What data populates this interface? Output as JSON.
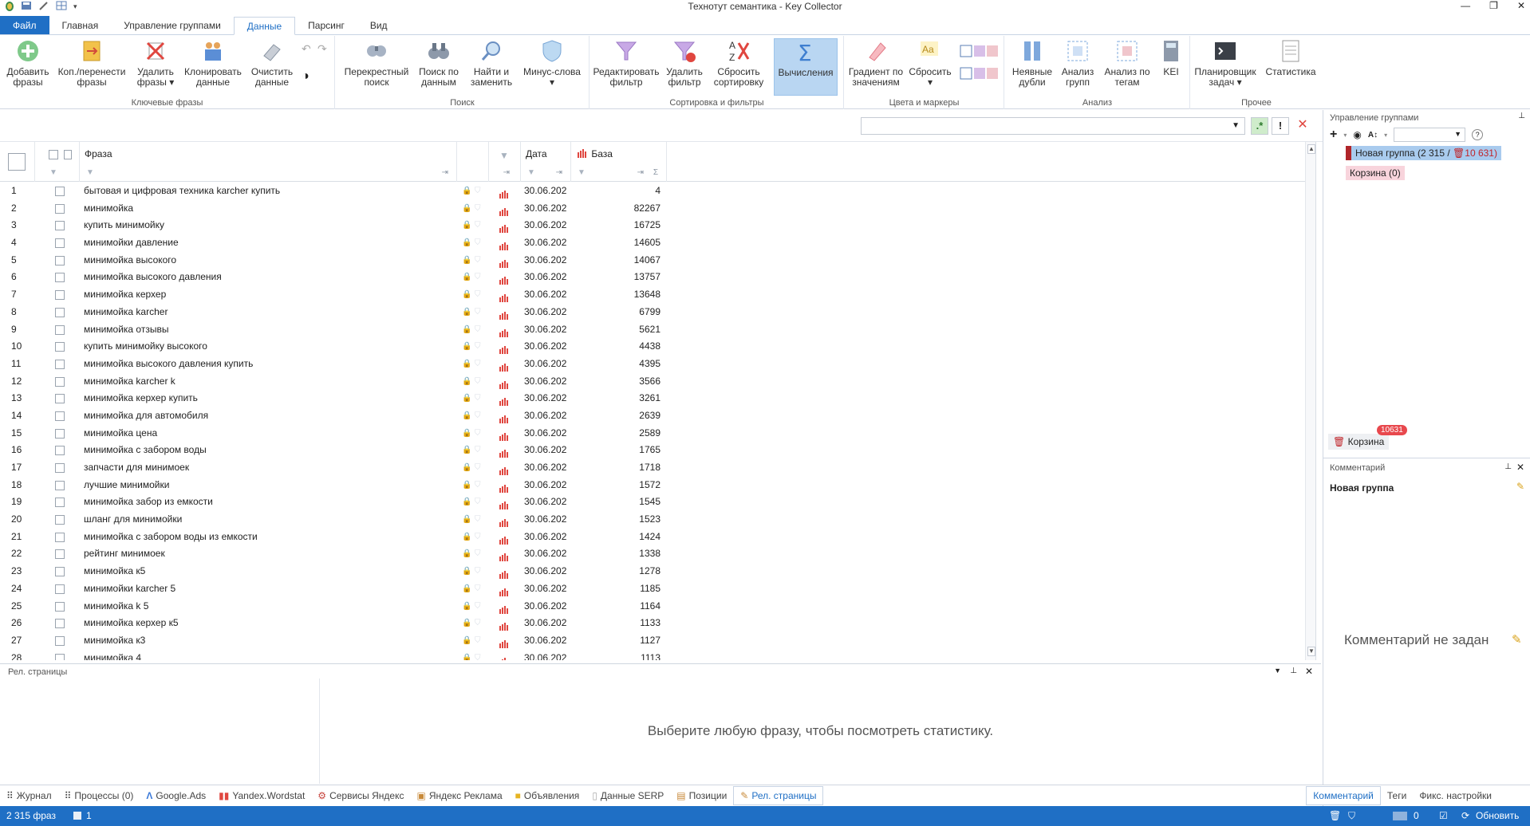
{
  "window": {
    "title": "Технотут семантика - Key Collector",
    "minimize": "—",
    "restore": "❐",
    "close": "✕"
  },
  "tabs": [
    "Файл",
    "Главная",
    "Управление группами",
    "Данные",
    "Парсинг",
    "Вид"
  ],
  "active_tab": "Данные",
  "ribbon": {
    "groups": {
      "keyphrases": "Ключевые фразы",
      "search": "Поиск",
      "sort": "Сортировка и фильтры",
      "colors": "Цвета и маркеры",
      "analysis": "Анализ",
      "other": "Прочее"
    },
    "add": [
      "Добавить",
      "фразы"
    ],
    "copymove": [
      "Коп./перенести",
      "фразы"
    ],
    "delete": [
      "Удалить",
      "фразы ▾"
    ],
    "clone": [
      "Клонировать",
      "данные"
    ],
    "clear": [
      "Очистить",
      "данные"
    ],
    "cross": [
      "Перекрестный",
      "поиск"
    ],
    "searchdata": [
      "Поиск по",
      "данным"
    ],
    "findreplace": [
      "Найти и",
      "заменить"
    ],
    "minus": [
      "Минус-слова",
      "▾"
    ],
    "editfilter": [
      "Редактировать",
      "фильтр"
    ],
    "delfilter": [
      "Удалить",
      "фильтр"
    ],
    "resetsort": [
      "Сбросить",
      "сортировку"
    ],
    "calc": [
      "Вычисления",
      ""
    ],
    "gradient": [
      "Градиент по",
      "значениям"
    ],
    "reset": [
      "Сбросить",
      "▾"
    ],
    "dups": [
      "Неявные",
      "дубли"
    ],
    "groups_a": [
      "Анализ",
      "групп"
    ],
    "tags_a": [
      "Анализ по",
      "тегам"
    ],
    "kei": [
      "KEI",
      ""
    ],
    "scheduler": [
      "Планировщик",
      "задач ▾"
    ],
    "stats": [
      "Статистика",
      ""
    ]
  },
  "grid": {
    "col_phrase": "Фраза",
    "col_date": "Дата",
    "col_base": "База",
    "rows": [
      {
        "n": "1",
        "phrase": "бытовая и цифровая техника karcher купить",
        "date": "30.06.202",
        "base": "4"
      },
      {
        "n": "2",
        "phrase": "минимойка",
        "date": "30.06.202",
        "base": "82267"
      },
      {
        "n": "3",
        "phrase": "купить минимойку",
        "date": "30.06.202",
        "base": "16725"
      },
      {
        "n": "4",
        "phrase": "минимойки давление",
        "date": "30.06.202",
        "base": "14605"
      },
      {
        "n": "5",
        "phrase": "минимойка высокого",
        "date": "30.06.202",
        "base": "14067"
      },
      {
        "n": "6",
        "phrase": "минимойка высокого давления",
        "date": "30.06.202",
        "base": "13757"
      },
      {
        "n": "7",
        "phrase": "минимойка керхер",
        "date": "30.06.202",
        "base": "13648"
      },
      {
        "n": "8",
        "phrase": "минимойка karcher",
        "date": "30.06.202",
        "base": "6799"
      },
      {
        "n": "9",
        "phrase": "минимойка отзывы",
        "date": "30.06.202",
        "base": "5621"
      },
      {
        "n": "10",
        "phrase": "купить минимойку высокого",
        "date": "30.06.202",
        "base": "4438"
      },
      {
        "n": "11",
        "phrase": "минимойка высокого давления купить",
        "date": "30.06.202",
        "base": "4395"
      },
      {
        "n": "12",
        "phrase": "минимойка karcher k",
        "date": "30.06.202",
        "base": "3566"
      },
      {
        "n": "13",
        "phrase": "минимойка керхер купить",
        "date": "30.06.202",
        "base": "3261"
      },
      {
        "n": "14",
        "phrase": "минимойка для автомобиля",
        "date": "30.06.202",
        "base": "2639"
      },
      {
        "n": "15",
        "phrase": "минимойка цена",
        "date": "30.06.202",
        "base": "2589"
      },
      {
        "n": "16",
        "phrase": "минимойка с забором воды",
        "date": "30.06.202",
        "base": "1765"
      },
      {
        "n": "17",
        "phrase": "запчасти для минимоек",
        "date": "30.06.202",
        "base": "1718"
      },
      {
        "n": "18",
        "phrase": "лучшие минимойки",
        "date": "30.06.202",
        "base": "1572"
      },
      {
        "n": "19",
        "phrase": "минимойка забор из емкости",
        "date": "30.06.202",
        "base": "1545"
      },
      {
        "n": "20",
        "phrase": "шланг для минимойки",
        "date": "30.06.202",
        "base": "1523"
      },
      {
        "n": "21",
        "phrase": "минимойка с забором воды из емкости",
        "date": "30.06.202",
        "base": "1424"
      },
      {
        "n": "22",
        "phrase": "рейтинг минимоек",
        "date": "30.06.202",
        "base": "1338"
      },
      {
        "n": "23",
        "phrase": "минимойка к5",
        "date": "30.06.202",
        "base": "1278"
      },
      {
        "n": "24",
        "phrase": "минимойки karcher 5",
        "date": "30.06.202",
        "base": "1185"
      },
      {
        "n": "25",
        "phrase": "минимойка k 5",
        "date": "30.06.202",
        "base": "1164"
      },
      {
        "n": "26",
        "phrase": "минимойка керхер к5",
        "date": "30.06.202",
        "base": "1133"
      },
      {
        "n": "27",
        "phrase": "минимойка к3",
        "date": "30.06.202",
        "base": "1127"
      },
      {
        "n": "28",
        "phrase": "минимойка 4",
        "date": "30.06.202",
        "base": "1113"
      }
    ]
  },
  "groups_panel": {
    "title": "Управление группами",
    "new_group_name": "Новая группа (2 315 /",
    "new_group_trash": "10 631)",
    "cart": "Корзина (0)",
    "cart_btn": "Корзина",
    "cart_badge": "10631"
  },
  "comment_panel": {
    "title": "Комментарий",
    "group": "Новая группа",
    "empty": "Комментарий не задан"
  },
  "bottom_panel": {
    "title": "Рел. страницы",
    "hint": "Выберите любую фразу, чтобы посмотреть статистику."
  },
  "bottom_tabs": [
    "Журнал",
    "Процессы (0)",
    "Google.Ads",
    "Yandex.Wordstat",
    "Сервисы Яндекс",
    "Яндекс Реклама",
    "Объявления",
    "Данные SERP",
    "Позиции",
    "Рел. страницы"
  ],
  "right_tabs": [
    "Комментарий",
    "Теги",
    "Фикс. настройки"
  ],
  "status": {
    "phrases": "2 315 фраз",
    "selected": "1",
    "tasks": "0",
    "refresh": "Обновить"
  },
  "colors": {
    "accent": "#1f6fc5",
    "group_selected": "#a9cbee",
    "cart_pink": "#f8d4dc",
    "badge_red": "#e8484d"
  }
}
